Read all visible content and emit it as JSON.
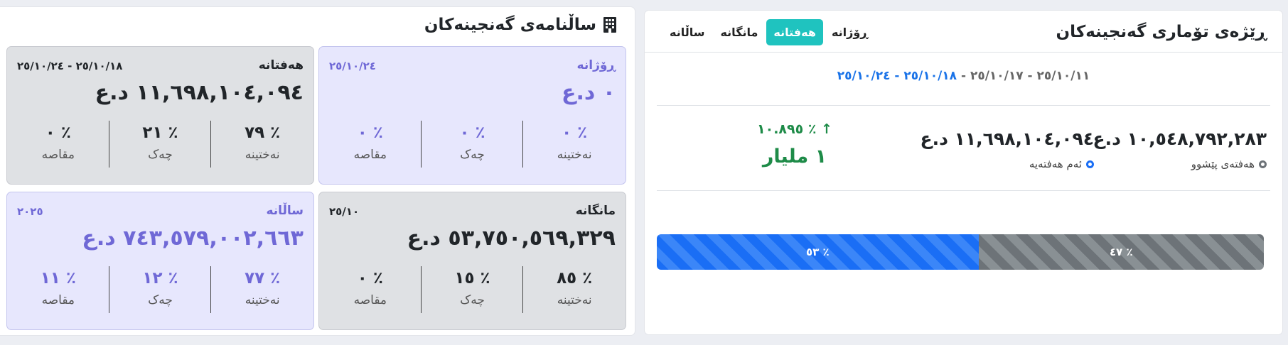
{
  "annual": {
    "title": "ساڵنامەی گەنجینەکان",
    "cards": {
      "daily": {
        "label": "ڕۆژانە",
        "date": "٢٥/١٠/٢٤",
        "amount": "٠ د.ع",
        "stats": [
          {
            "value": "٪ ٠",
            "label": "نەختینە"
          },
          {
            "value": "٪ ٠",
            "label": "چەک"
          },
          {
            "value": "٪ ٠",
            "label": "مقاصە"
          }
        ]
      },
      "weekly": {
        "label": "هەفتانە",
        "date": "٢٥/١٠/١٨ - ٢٥/١٠/٢٤",
        "amount": "١١,٦٩٨,١٠٤,٠٩٤ د.ع",
        "stats": [
          {
            "value": "٪ ٧٩",
            "label": "نەختینە"
          },
          {
            "value": "٪ ٢١",
            "label": "چەک"
          },
          {
            "value": "٪ ٠",
            "label": "مقاصە"
          }
        ]
      },
      "monthly": {
        "label": "مانگانە",
        "date": "٢٥/١٠",
        "amount": "٥٣,٧٥٠,٥٦٩,٣٢٩ د.ع",
        "stats": [
          {
            "value": "٪ ٨٥",
            "label": "نەختینە"
          },
          {
            "value": "٪ ١٥",
            "label": "چەک"
          },
          {
            "value": "٪ ٠",
            "label": "مقاصە"
          }
        ]
      },
      "yearly": {
        "label": "ساڵانە",
        "date": "٢٠٢٥",
        "amount": "٧٤٣,٥٧٩,٠٠٢,٦٦٣ د.ع",
        "stats": [
          {
            "value": "٪ ٧٧",
            "label": "نەختینە"
          },
          {
            "value": "٪ ١٢",
            "label": "چەک"
          },
          {
            "value": "٪ ١١",
            "label": "مقاصە"
          }
        ]
      }
    }
  },
  "compare": {
    "title": "ڕێژەی تۆماری گەنجینەکان",
    "tabs": [
      "ڕۆژانە",
      "هەفتانە",
      "مانگانە",
      "ساڵانە"
    ],
    "active_tab": "هەفتانە",
    "range_prev": "٢٥/١٠/١١ - ٢٥/١٠/١٧",
    "range_sep": " - ",
    "range_cur": "٢٥/١٠/١٨ - ٢٥/١٠/٢٤",
    "prev_amount": "١٠,٥٤٨,٧٩٢,٢٨٣ د.ع",
    "prev_label": "هەفتەی پێشوو",
    "cur_amount": "١١,٦٩٨,١٠٤,٠٩٤ د.ع",
    "cur_label": "ئەم هەفتەیە",
    "change_pct": "٪ ١٠.٨٩٥",
    "change_abs": "١ مليار",
    "bar_cur_label": "٪ ٥٣",
    "bar_prev_label": "٪ ٤٧",
    "bar_cur_fraction": 0.53,
    "bar_prev_fraction": 0.47,
    "colors": {
      "accent": "#1fc3bf",
      "current": "#1a6ef5",
      "previous": "#6d7378",
      "increase": "#1e8b48"
    }
  }
}
